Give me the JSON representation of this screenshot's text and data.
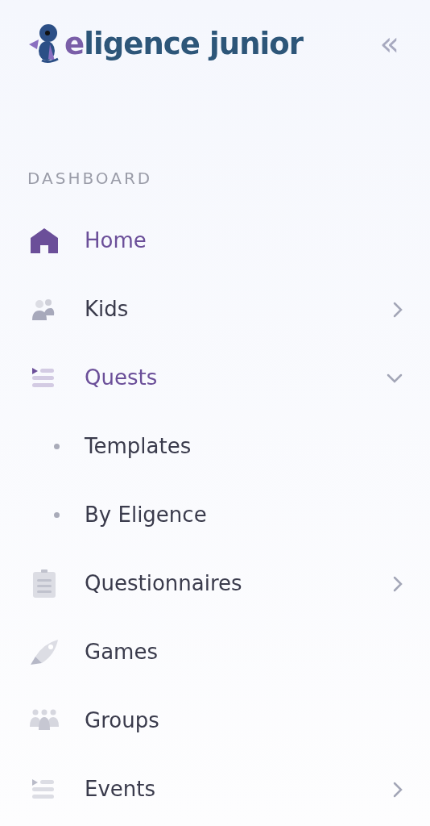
{
  "logo": {
    "accent": "e",
    "rest": "ligence junior"
  },
  "collapse_button": {
    "label": "«"
  },
  "section_label": "DASHBOARD",
  "menu": [
    {
      "label": "Home",
      "kind": "link",
      "selected": true
    },
    {
      "label": "Kids",
      "kind": "group",
      "selected": false,
      "expanded": false
    },
    {
      "label": "Quests",
      "kind": "group",
      "selected": false,
      "expanded": true,
      "children": [
        {
          "label": "Templates",
          "selected": false
        },
        {
          "label": "By Eligence",
          "selected": false
        }
      ]
    },
    {
      "label": "Questionnaires",
      "kind": "group",
      "selected": false,
      "expanded": false
    },
    {
      "label": "Games",
      "kind": "link",
      "selected": false
    },
    {
      "label": "Groups",
      "kind": "link",
      "selected": false
    },
    {
      "label": "Events",
      "kind": "group",
      "selected": false,
      "expanded": false
    }
  ]
}
